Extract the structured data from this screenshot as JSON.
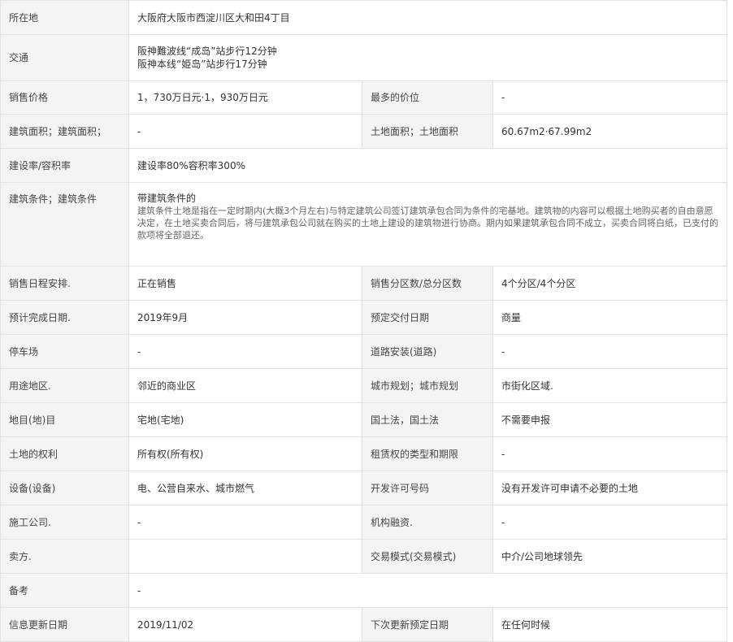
{
  "rows": {
    "location": {
      "label": "所在地",
      "value": "大阪府大阪市西淀川区大和田4丁目"
    },
    "transport": {
      "label": "交通",
      "line1": "阪神難波线“成岛”站步行12分钟",
      "line2": "阪神本线“姫岛”站步行17分钟"
    },
    "price": {
      "label": "销售价格",
      "value": "1，730万日元·1，930万日元",
      "label2": "最多的价位",
      "value2": "-"
    },
    "building_area": {
      "label": "建筑面积；建筑面积；",
      "value": "-",
      "label2": "土地面积；土地面积",
      "value2": "60.67m2·67.99m2"
    },
    "coverage": {
      "label": "建设率/容积率",
      "value": "建设率80%容积率300%"
    },
    "conditions": {
      "label": "建筑条件；建筑条件",
      "title": "带建筑条件的",
      "desc": "建筑条件土地是指在一定时期内(大概3个月左右)与特定建筑公司签订建筑承包合同为条件的宅基地。建筑物的内容可以根据土地购买者的自由意愿决定，在土地买卖合同后，将与建筑承包公司就在购买的土地上建设的建筑物进行协商。期内如果建筑承包合同不成立，买卖合同将白纸，已支付的款项将全部退还。"
    },
    "schedule": {
      "label": "销售日程安排.",
      "value": "正在销售",
      "label2": "销售分区数/总分区数",
      "value2": "4个分区/4个分区"
    },
    "completion": {
      "label": "预计完成日期.",
      "value": "2019年9月",
      "label2": "预定交付日期",
      "value2": "商量"
    },
    "parking": {
      "label": "停车场",
      "value": "-",
      "label2": "道路安装(道路)",
      "value2": "-"
    },
    "zoning": {
      "label": "用途地区.",
      "value": "邻近的商业区",
      "label2": "城市规划；城市规划",
      "value2": "市街化区域."
    },
    "land_category": {
      "label": "地目(地)目",
      "value": "宅地(宅地)",
      "label2": "国土法，国土法",
      "value2": "不需要申报"
    },
    "land_rights": {
      "label": "土地的权利",
      "value": "所有权(所有权)",
      "label2": "租赁权的类型和期限",
      "value2": "-"
    },
    "facilities": {
      "label": "设备(设备)",
      "value": "电、公营自来水、城市燃气",
      "label2": "开发许可号码",
      "value2": "没有开发许可申请不必要的土地"
    },
    "contractor": {
      "label": "施工公司.",
      "value": "-",
      "label2": "机构融资.",
      "value2": "-"
    },
    "seller": {
      "label": "卖方.",
      "value": "",
      "label2": "交易模式(交易模式)",
      "value2": "中介/公司地球领先"
    },
    "remarks": {
      "label": "备考",
      "value": "-"
    },
    "updated": {
      "label": "信息更新日期",
      "value": "2019/11/02",
      "label2": "下次更新预定日期",
      "value2": "在任何时候"
    }
  }
}
